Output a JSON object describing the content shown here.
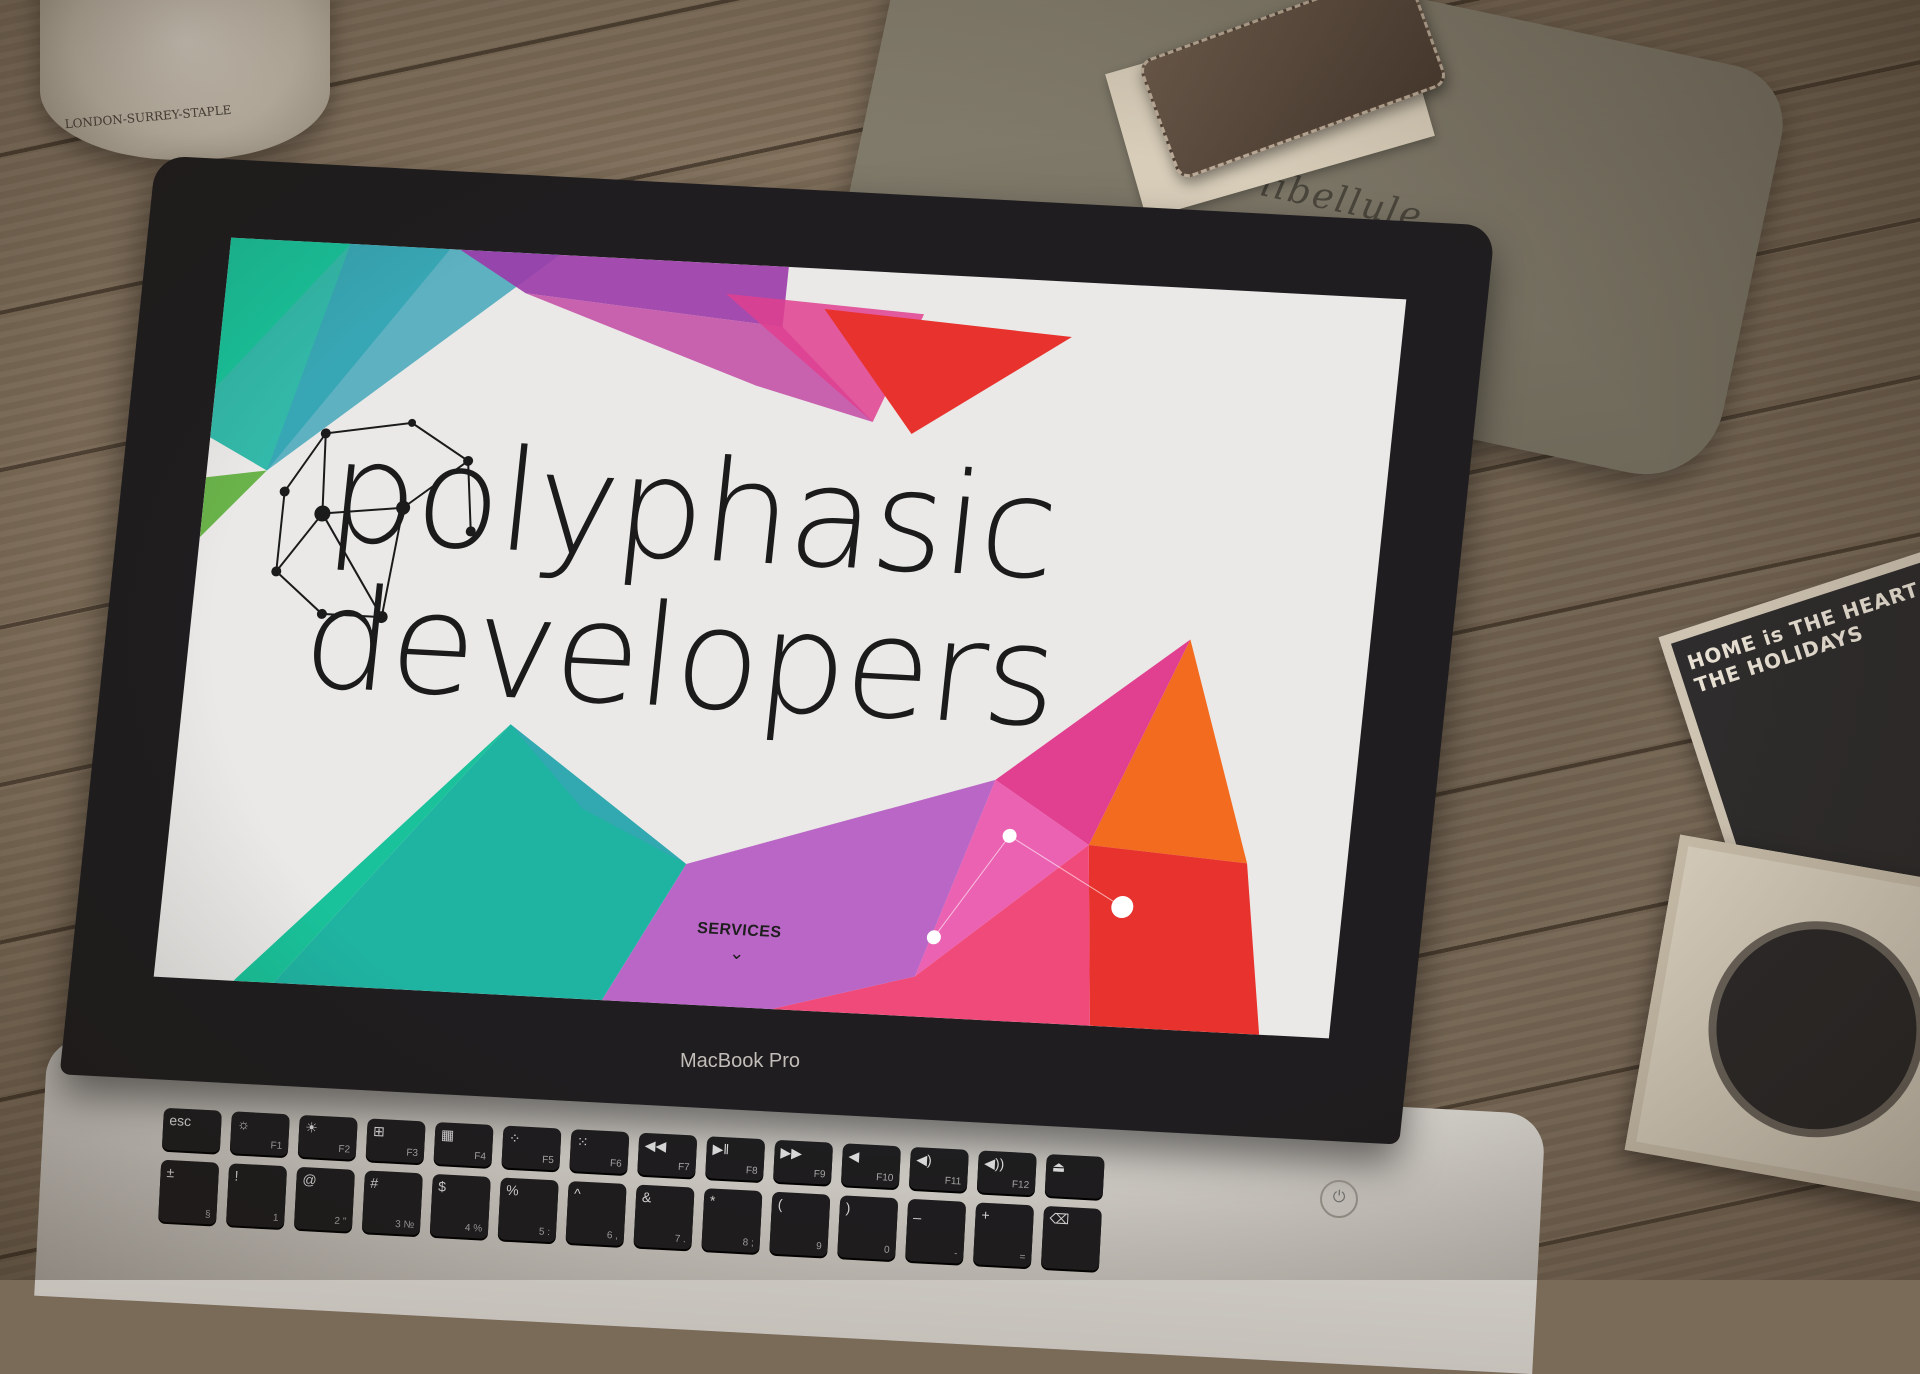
{
  "scene": {
    "jar_label": "LONDON-SURREY-STAPLE",
    "pouch_text": "la libellule",
    "coaster_top_text": "HOME is THE HEART OF THE HOLIDAYS"
  },
  "laptop": {
    "brand": "MacBook Pro"
  },
  "website": {
    "logo_line1": "polyphasic",
    "logo_line2": "developers",
    "nav_label": "SERVICES",
    "nav_icon": "chevron-down-icon"
  },
  "keyboard": {
    "fn_row": [
      {
        "main": "esc",
        "sub": ""
      },
      {
        "main": "☼",
        "sub": "F1"
      },
      {
        "main": "☀",
        "sub": "F2"
      },
      {
        "main": "⊞",
        "sub": "F3"
      },
      {
        "main": "▦",
        "sub": "F4"
      },
      {
        "main": "⁘",
        "sub": "F5"
      },
      {
        "main": "⁙",
        "sub": "F6"
      },
      {
        "main": "◀◀",
        "sub": "F7"
      },
      {
        "main": "▶‖",
        "sub": "F8"
      },
      {
        "main": "▶▶",
        "sub": "F9"
      },
      {
        "main": "◀",
        "sub": "F10"
      },
      {
        "main": "◀)",
        "sub": "F11"
      },
      {
        "main": "◀))",
        "sub": "F12"
      },
      {
        "main": "⏏",
        "sub": ""
      }
    ],
    "num_row": [
      {
        "main": "±",
        "sub": "§"
      },
      {
        "main": "!",
        "sub": "1"
      },
      {
        "main": "@",
        "sub": "2 \""
      },
      {
        "main": "#",
        "sub": "3 №"
      },
      {
        "main": "$",
        "sub": "4 %"
      },
      {
        "main": "%",
        "sub": "5 :"
      },
      {
        "main": "^",
        "sub": "6 ,"
      },
      {
        "main": "&",
        "sub": "7 ."
      },
      {
        "main": "*",
        "sub": "8 ;"
      },
      {
        "main": "(",
        "sub": "9"
      },
      {
        "main": ")",
        "sub": "0"
      },
      {
        "main": "_",
        "sub": "-"
      },
      {
        "main": "+",
        "sub": "="
      },
      {
        "main": "⌫",
        "sub": ""
      }
    ],
    "power_symbol": "⏻"
  },
  "colors": {
    "teal": "#1fb4a2",
    "purple": "#9b3aa8",
    "magenta": "#e0408f",
    "red": "#e8322e",
    "orange": "#f26b1f",
    "screen_bg": "#eae9e7"
  }
}
